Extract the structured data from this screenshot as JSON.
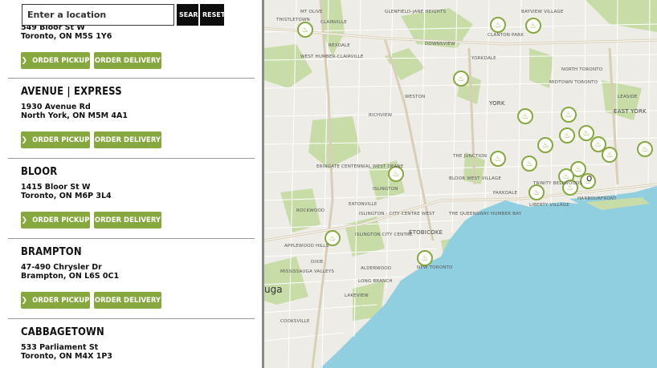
{
  "search": {
    "placeholder": "Enter a location",
    "search_label": "SEARCH",
    "reset_label": "RESET"
  },
  "buttons": {
    "pickup_label": "ORDER PICKUP",
    "delivery_label": "ORDER DELIVERY",
    "pickup_chevron": "❯"
  },
  "stores": [
    {
      "name": "",
      "street": "549 Bloor St W",
      "city": "Toronto, ON M5S 1Y6"
    },
    {
      "name": "Avenue | Express",
      "street": "1930 Avenue Rd",
      "city": "North York, ON M5M 4A1"
    },
    {
      "name": "Bloor",
      "street": "1415 Bloor St W",
      "city": "Toronto, ON M6P 3L4"
    },
    {
      "name": "Brampton",
      "street": "47-490 Chrysler Dr",
      "city": "Brampton, ON L6S 0C1"
    },
    {
      "name": "Cabbagetown",
      "street": "533 Parliament St",
      "city": "Toronto, ON M4X 1P3"
    }
  ],
  "map": {
    "colors": {
      "land": "#eeece6",
      "water": "#8fcfe0",
      "park": "#c8dca8",
      "road": "#ffffff",
      "highway": "#d9cfb8",
      "marker": "#86a83e"
    },
    "marker_icon": "store-pin-icon",
    "labels": [
      {
        "text": "MT OLIVE",
        "cls": ""
      },
      {
        "text": "GLENFIELD-JANE HEIGHTS",
        "cls": ""
      },
      {
        "text": "BAYVIEW VILLAGE",
        "cls": ""
      },
      {
        "text": "THISTLETOWN",
        "cls": ""
      },
      {
        "text": "CLAIRVILLE",
        "cls": ""
      },
      {
        "text": "CLANTON PARK",
        "cls": ""
      },
      {
        "text": "REXDALE",
        "cls": ""
      },
      {
        "text": "DOWNSVIEW",
        "cls": ""
      },
      {
        "text": "WEST HUMBER-CLAIRVILLE",
        "cls": ""
      },
      {
        "text": "YORKDALE",
        "cls": ""
      },
      {
        "text": "NORTH TORONTO",
        "cls": ""
      },
      {
        "text": "MIDTOWN TORONTO",
        "cls": ""
      },
      {
        "text": "WESTON",
        "cls": ""
      },
      {
        "text": "LEASIDE",
        "cls": ""
      },
      {
        "text": "YORK",
        "cls": "big"
      },
      {
        "text": "EAST YORK",
        "cls": "big"
      },
      {
        "text": "RICHVIEW",
        "cls": ""
      },
      {
        "text": "THE JUNCTION",
        "cls": ""
      },
      {
        "text": "ERINGATE CENTENNIAL WEST DEANE",
        "cls": ""
      },
      {
        "text": "ISLINGTON",
        "cls": ""
      },
      {
        "text": "BLOOR WEST VILLAGE",
        "cls": ""
      },
      {
        "text": "TRINITY BELLWOODS",
        "cls": ""
      },
      {
        "text": "PARKDALE",
        "cls": ""
      },
      {
        "text": "LIBERTY VILLAGE",
        "cls": ""
      },
      {
        "text": "HARBOURFRONT",
        "cls": ""
      },
      {
        "text": "ROCKWOOD",
        "cls": ""
      },
      {
        "text": "EATONVILLE",
        "cls": ""
      },
      {
        "text": "ISLINGTON - CITY CENTRE WEST",
        "cls": ""
      },
      {
        "text": "THE QUEENSWAY HUMBER BAY",
        "cls": ""
      },
      {
        "text": "ETOBICOKE",
        "cls": "big"
      },
      {
        "text": "ISLINGTON CITY CENTRE",
        "cls": ""
      },
      {
        "text": "APPLEWOOD HILLS",
        "cls": ""
      },
      {
        "text": "DIXIE",
        "cls": ""
      },
      {
        "text": "MISSISSAUGA VALLEYS",
        "cls": ""
      },
      {
        "text": "ALDERWOOD",
        "cls": ""
      },
      {
        "text": "NEW TORONTO",
        "cls": ""
      },
      {
        "text": "LONG BRANCH",
        "cls": ""
      },
      {
        "text": "LAKEVIEW",
        "cls": ""
      },
      {
        "text": "COOKSVILLE",
        "cls": ""
      },
      {
        "text": "uga",
        "cls": "city"
      },
      {
        "text": "o",
        "cls": "city"
      }
    ]
  }
}
